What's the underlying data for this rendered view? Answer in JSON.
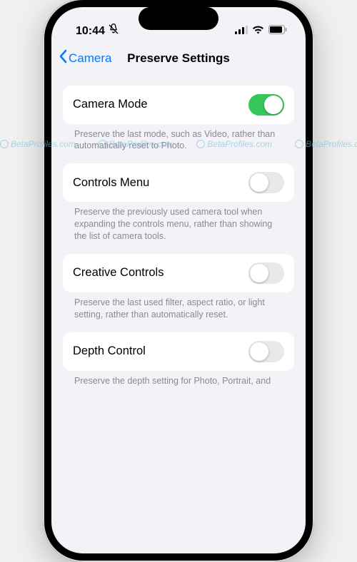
{
  "status": {
    "time": "10:44",
    "silent_icon": "bell-slash"
  },
  "nav": {
    "back_label": "Camera",
    "title": "Preserve Settings"
  },
  "settings": [
    {
      "label": "Camera Mode",
      "on": true,
      "description": "Preserve the last mode, such as Video, rather than automatically reset to Photo."
    },
    {
      "label": "Controls Menu",
      "on": false,
      "description": "Preserve the previously used camera tool when expanding the controls menu, rather than showing the list of camera tools."
    },
    {
      "label": "Creative Controls",
      "on": false,
      "description": "Preserve the last used filter, aspect ratio, or light setting, rather than automatically reset."
    },
    {
      "label": "Depth Control",
      "on": false,
      "description": "Preserve the depth setting for Photo, Portrait, and"
    }
  ],
  "watermark": {
    "text": "BetaProfiles.com"
  }
}
